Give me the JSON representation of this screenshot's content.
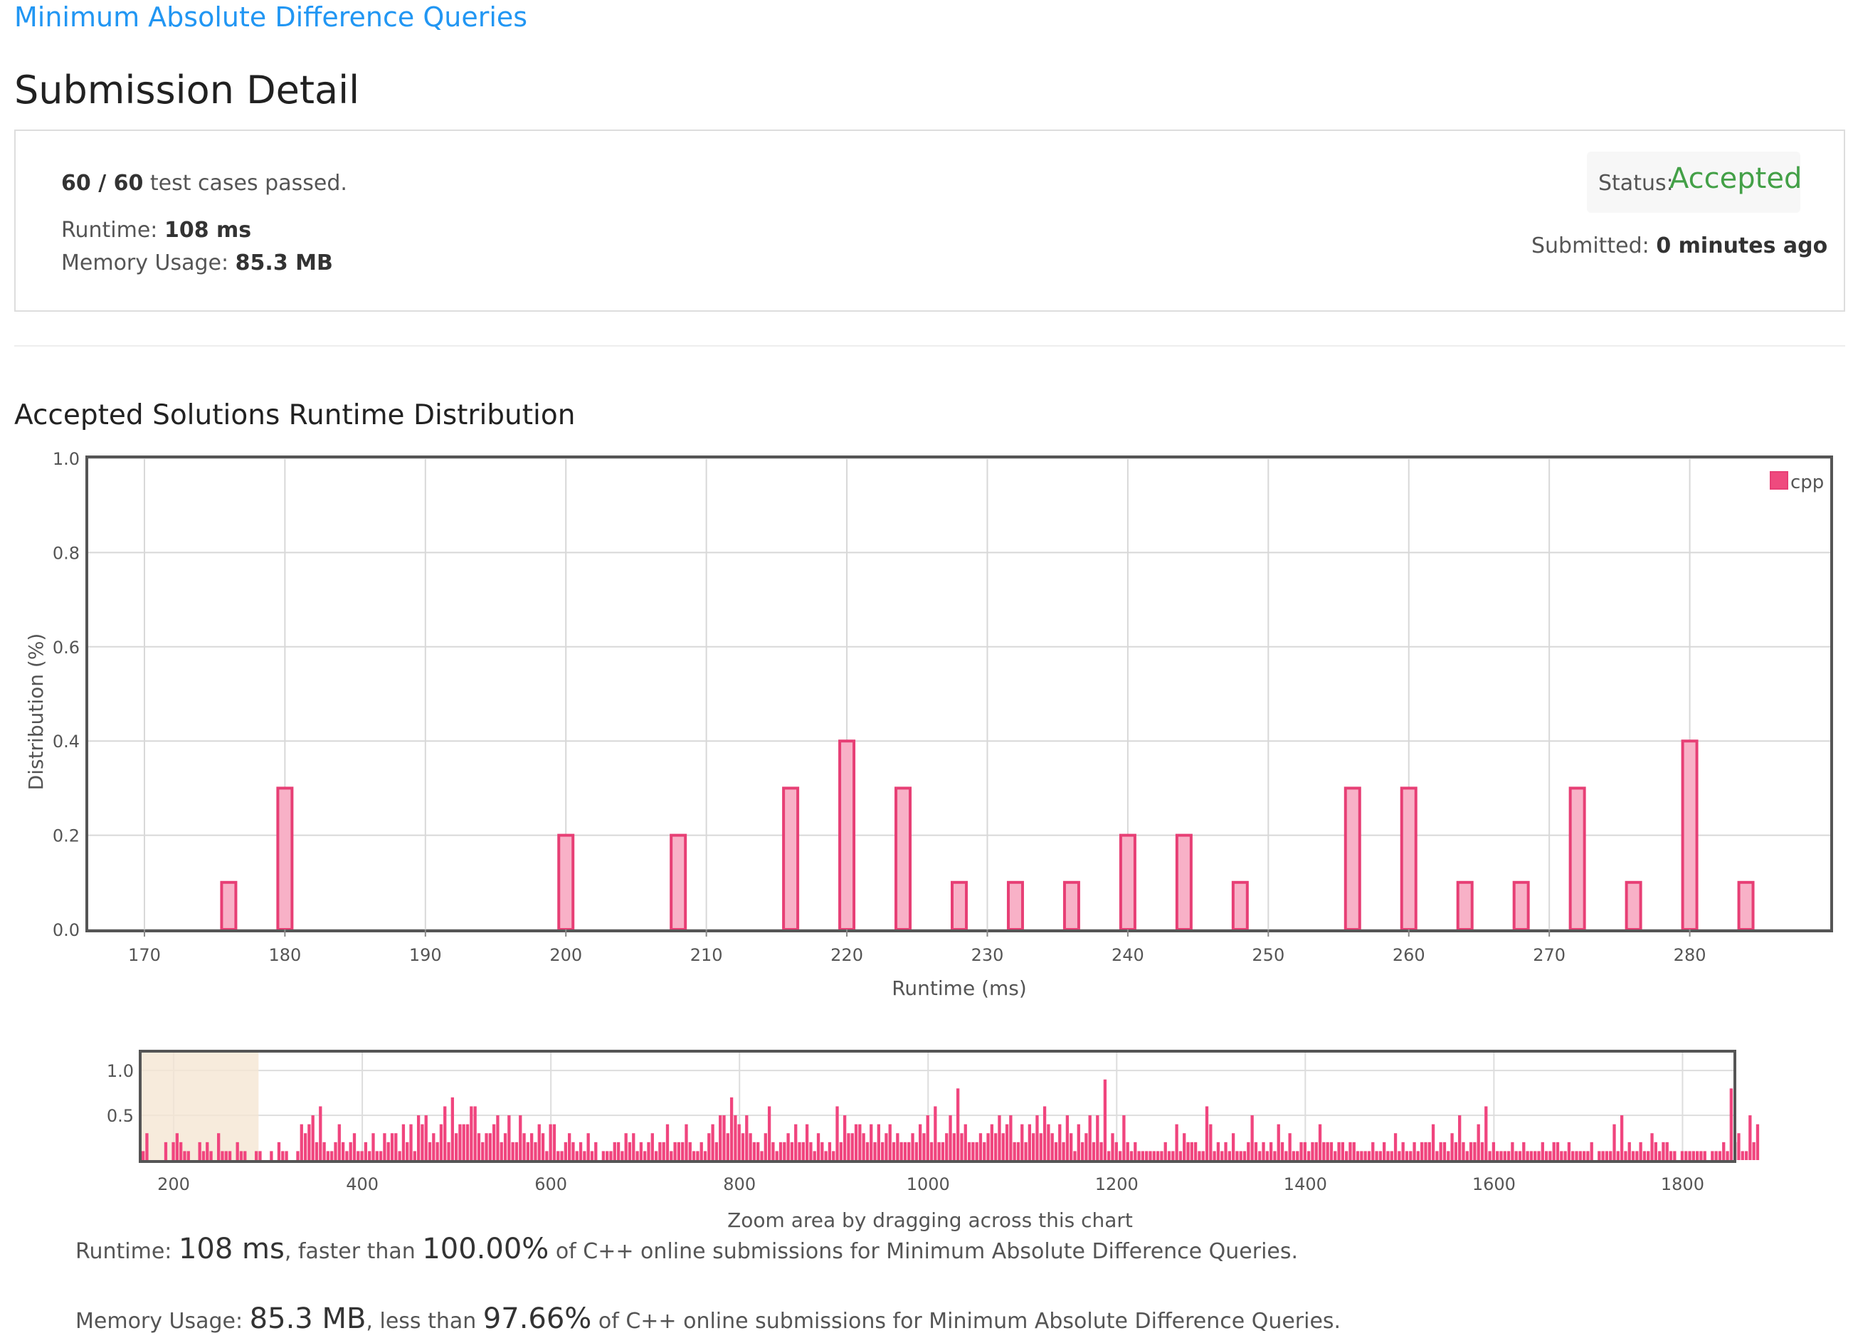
{
  "problem": {
    "title": "Minimum Absolute Difference Queries"
  },
  "page_title": "Submission Detail",
  "summary": {
    "cases_passed": "60 / 60",
    "cases_suffix": "test cases passed.",
    "runtime_label": "Runtime:",
    "runtime_value": "108 ms",
    "memory_label": "Memory Usage:",
    "memory_value": "85.3 MB",
    "status_label": "Status:",
    "status_value": "Accepted",
    "submitted_label": "Submitted:",
    "submitted_value": "0 minutes ago"
  },
  "colors": {
    "link": "#2196f3",
    "accepted": "#43a047",
    "bar_fill": "#f8b1c7",
    "bar_stroke": "#e73f75",
    "nav_bar": "#f0457e",
    "nav_window": "#f5e6d3"
  },
  "section_title": "Accepted Solutions Runtime Distribution",
  "chart_data": [
    {
      "type": "bar",
      "xlabel": "Runtime (ms)",
      "ylabel": "Distribution (%)",
      "xlim": [
        166,
        290
      ],
      "ylim": [
        0,
        1.0
      ],
      "x_ticks": [
        170,
        180,
        190,
        200,
        210,
        220,
        230,
        240,
        250,
        260,
        270,
        280
      ],
      "y_ticks": [
        0.0,
        0.2,
        0.4,
        0.6,
        0.8,
        1.0
      ],
      "grid": true,
      "legend_position": "top-right",
      "series": [
        {
          "name": "cpp",
          "x": [
            176,
            180,
            200,
            208,
            216,
            220,
            224,
            228,
            232,
            236,
            240,
            244,
            248,
            256,
            260,
            264,
            268,
            272,
            276,
            280,
            284
          ],
          "values": [
            0.1,
            0.3,
            0.2,
            0.2,
            0.3,
            0.4,
            0.3,
            0.1,
            0.1,
            0.1,
            0.2,
            0.2,
            0.1,
            0.3,
            0.3,
            0.1,
            0.1,
            0.3,
            0.1,
            0.4,
            0.1
          ]
        }
      ]
    },
    {
      "type": "bar",
      "role": "navigator",
      "xlim": [
        166,
        1854
      ],
      "ylim": [
        0,
        1.2
      ],
      "x_ticks": [
        200,
        400,
        600,
        800,
        1000,
        1200,
        1400,
        1600,
        1800
      ],
      "y_ticks": [
        0.5,
        1.0
      ],
      "selected_range": [
        166,
        290
      ],
      "caption": "Zoom area by dragging across this chart",
      "bin_width": 4,
      "values": [
        0.1,
        0.3,
        0.0,
        0.0,
        0.0,
        0.0,
        0.2,
        0.0,
        0.2,
        0.3,
        0.2,
        0.1,
        0.1,
        0.0,
        0.0,
        0.2,
        0.1,
        0.2,
        0.1,
        0.0,
        0.3,
        0.1,
        0.1,
        0.1,
        0.0,
        0.2,
        0.1,
        0.1,
        0.0,
        0.0,
        0.1,
        0.1,
        0.0,
        0.0,
        0.1,
        0.0,
        0.2,
        0.1,
        0.1,
        0.0,
        0.0,
        0.1,
        0.4,
        0.3,
        0.4,
        0.5,
        0.2,
        0.6,
        0.2,
        0.1,
        0.1,
        0.2,
        0.4,
        0.2,
        0.1,
        0.2,
        0.3,
        0.1,
        0.1,
        0.2,
        0.1,
        0.3,
        0.1,
        0.1,
        0.3,
        0.2,
        0.3,
        0.3,
        0.1,
        0.4,
        0.2,
        0.4,
        0.1,
        0.5,
        0.4,
        0.5,
        0.2,
        0.3,
        0.2,
        0.4,
        0.6,
        0.2,
        0.7,
        0.3,
        0.4,
        0.4,
        0.4,
        0.6,
        0.6,
        0.3,
        0.2,
        0.3,
        0.3,
        0.4,
        0.5,
        0.2,
        0.3,
        0.5,
        0.2,
        0.2,
        0.5,
        0.3,
        0.2,
        0.3,
        0.2,
        0.4,
        0.3,
        0.1,
        0.4,
        0.4,
        0.1,
        0.1,
        0.2,
        0.3,
        0.2,
        0.1,
        0.2,
        0.1,
        0.3,
        0.1,
        0.2,
        0.0,
        0.1,
        0.1,
        0.1,
        0.2,
        0.2,
        0.1,
        0.3,
        0.2,
        0.3,
        0.1,
        0.2,
        0.1,
        0.2,
        0.3,
        0.1,
        0.2,
        0.2,
        0.4,
        0.1,
        0.2,
        0.2,
        0.2,
        0.4,
        0.2,
        0.1,
        0.1,
        0.2,
        0.1,
        0.3,
        0.4,
        0.2,
        0.5,
        0.5,
        0.3,
        0.7,
        0.5,
        0.4,
        0.3,
        0.5,
        0.3,
        0.2,
        0.2,
        0.1,
        0.3,
        0.6,
        0.2,
        0.1,
        0.2,
        0.2,
        0.3,
        0.2,
        0.4,
        0.2,
        0.2,
        0.4,
        0.2,
        0.1,
        0.3,
        0.2,
        0.1,
        0.2,
        0.1,
        0.6,
        0.2,
        0.5,
        0.3,
        0.3,
        0.4,
        0.4,
        0.3,
        0.2,
        0.4,
        0.2,
        0.4,
        0.2,
        0.3,
        0.4,
        0.2,
        0.3,
        0.2,
        0.2,
        0.2,
        0.3,
        0.2,
        0.4,
        0.3,
        0.5,
        0.2,
        0.6,
        0.2,
        0.2,
        0.3,
        0.5,
        0.3,
        0.8,
        0.3,
        0.4,
        0.2,
        0.2,
        0.2,
        0.3,
        0.2,
        0.3,
        0.4,
        0.3,
        0.5,
        0.3,
        0.4,
        0.5,
        0.2,
        0.2,
        0.4,
        0.2,
        0.4,
        0.3,
        0.5,
        0.3,
        0.6,
        0.4,
        0.3,
        0.2,
        0.4,
        0.2,
        0.5,
        0.3,
        0.1,
        0.4,
        0.2,
        0.3,
        0.5,
        0.2,
        0.5,
        0.2,
        0.9,
        0.1,
        0.3,
        0.2,
        0.1,
        0.5,
        0.2,
        0.1,
        0.2,
        0.1,
        0.1,
        0.1,
        0.1,
        0.1,
        0.1,
        0.1,
        0.2,
        0.1,
        0.1,
        0.4,
        0.1,
        0.3,
        0.2,
        0.2,
        0.2,
        0.1,
        0.1,
        0.6,
        0.4,
        0.1,
        0.2,
        0.1,
        0.2,
        0.1,
        0.3,
        0.1,
        0.1,
        0.1,
        0.2,
        0.5,
        0.2,
        0.1,
        0.2,
        0.1,
        0.2,
        0.1,
        0.4,
        0.2,
        0.1,
        0.3,
        0.1,
        0.1,
        0.2,
        0.2,
        0.1,
        0.2,
        0.2,
        0.4,
        0.2,
        0.2,
        0.2,
        0.1,
        0.2,
        0.2,
        0.1,
        0.2,
        0.2,
        0.1,
        0.1,
        0.1,
        0.1,
        0.2,
        0.1,
        0.1,
        0.2,
        0.1,
        0.1,
        0.3,
        0.1,
        0.2,
        0.1,
        0.1,
        0.2,
        0.1,
        0.2,
        0.2,
        0.2,
        0.4,
        0.1,
        0.2,
        0.2,
        0.1,
        0.3,
        0.2,
        0.5,
        0.2,
        0.1,
        0.2,
        0.2,
        0.4,
        0.2,
        0.6,
        0.1,
        0.2,
        0.1,
        0.1,
        0.1,
        0.1,
        0.2,
        0.1,
        0.1,
        0.2,
        0.1,
        0.1,
        0.1,
        0.1,
        0.2,
        0.1,
        0.1,
        0.2,
        0.2,
        0.1,
        0.1,
        0.2,
        0.1,
        0.1,
        0.1,
        0.1,
        0.1,
        0.2,
        0.0,
        0.1,
        0.1,
        0.1,
        0.1,
        0.4,
        0.1,
        0.5,
        0.1,
        0.2,
        0.1,
        0.1,
        0.2,
        0.1,
        0.1,
        0.3,
        0.2,
        0.1,
        0.2,
        0.2,
        0.1,
        0.1,
        0.0,
        0.1,
        0.1,
        0.1,
        0.1,
        0.1,
        0.1,
        0.1,
        0.0,
        0.1,
        0.1,
        0.1,
        0.2,
        0.1,
        0.8,
        0.2,
        0.3,
        0.1,
        0.1,
        0.5,
        0.2,
        0.4
      ]
    }
  ],
  "results": {
    "runtime_label": "Runtime:",
    "runtime_value": "108 ms",
    "runtime_mid": ", faster than",
    "runtime_percent": "100.00%",
    "runtime_tail": "of C++ online submissions for Minimum Absolute Difference Queries.",
    "memory_label": "Memory Usage:",
    "memory_value": "85.3 MB",
    "memory_mid": ", less than",
    "memory_percent": "97.66%",
    "memory_tail": "of C++ online submissions for Minimum Absolute Difference Queries."
  }
}
